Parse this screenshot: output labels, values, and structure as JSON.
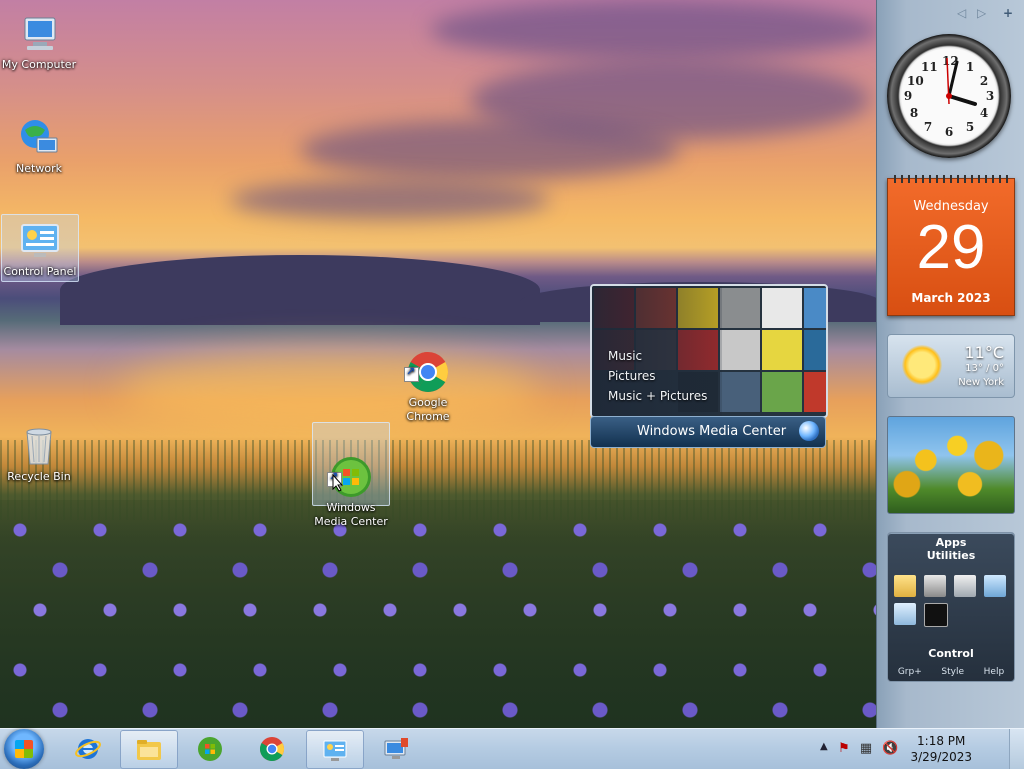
{
  "desktop": {
    "icons": [
      {
        "label": "My Computer",
        "icon": "computer-icon"
      },
      {
        "label": "Network",
        "icon": "network-icon"
      },
      {
        "label": "Control Panel",
        "icon": "control-panel-icon"
      },
      {
        "label": "Recycle Bin",
        "icon": "recycle-bin-icon"
      },
      {
        "label": "Google\nChrome",
        "icon": "chrome-icon"
      },
      {
        "label": "Windows\nMedia Center",
        "icon": "media-center-icon"
      }
    ]
  },
  "media_center": {
    "menu": [
      "Music",
      "Pictures",
      "Music + Pictures"
    ],
    "title": "Windows Media Center"
  },
  "sidebar": {
    "clock_numbers": [
      "12",
      "1",
      "2",
      "3",
      "4",
      "5",
      "6",
      "7",
      "8",
      "9",
      "10",
      "11"
    ],
    "calendar": {
      "weekday": "Wednesday",
      "day": "29",
      "month_year": "March 2023"
    },
    "weather": {
      "temp": "11°C",
      "range": "13° / 0°",
      "city": "New York"
    },
    "apps": {
      "title": "Apps",
      "section1": "Utilities",
      "section2": "Control",
      "footer": [
        "Grp+",
        "Style",
        "Help"
      ]
    }
  },
  "taskbar": {
    "time": "1:18 PM",
    "date": "3/29/2023",
    "pinned": [
      "internet-explorer-icon",
      "file-explorer-icon",
      "media-center-icon",
      "chrome-icon",
      "control-panel-icon",
      "remote-desktop-icon"
    ]
  },
  "colors": {
    "calendar": "#e8561a",
    "taskbar": "#b4cbe2",
    "sidebar": "#a7b9cc"
  }
}
